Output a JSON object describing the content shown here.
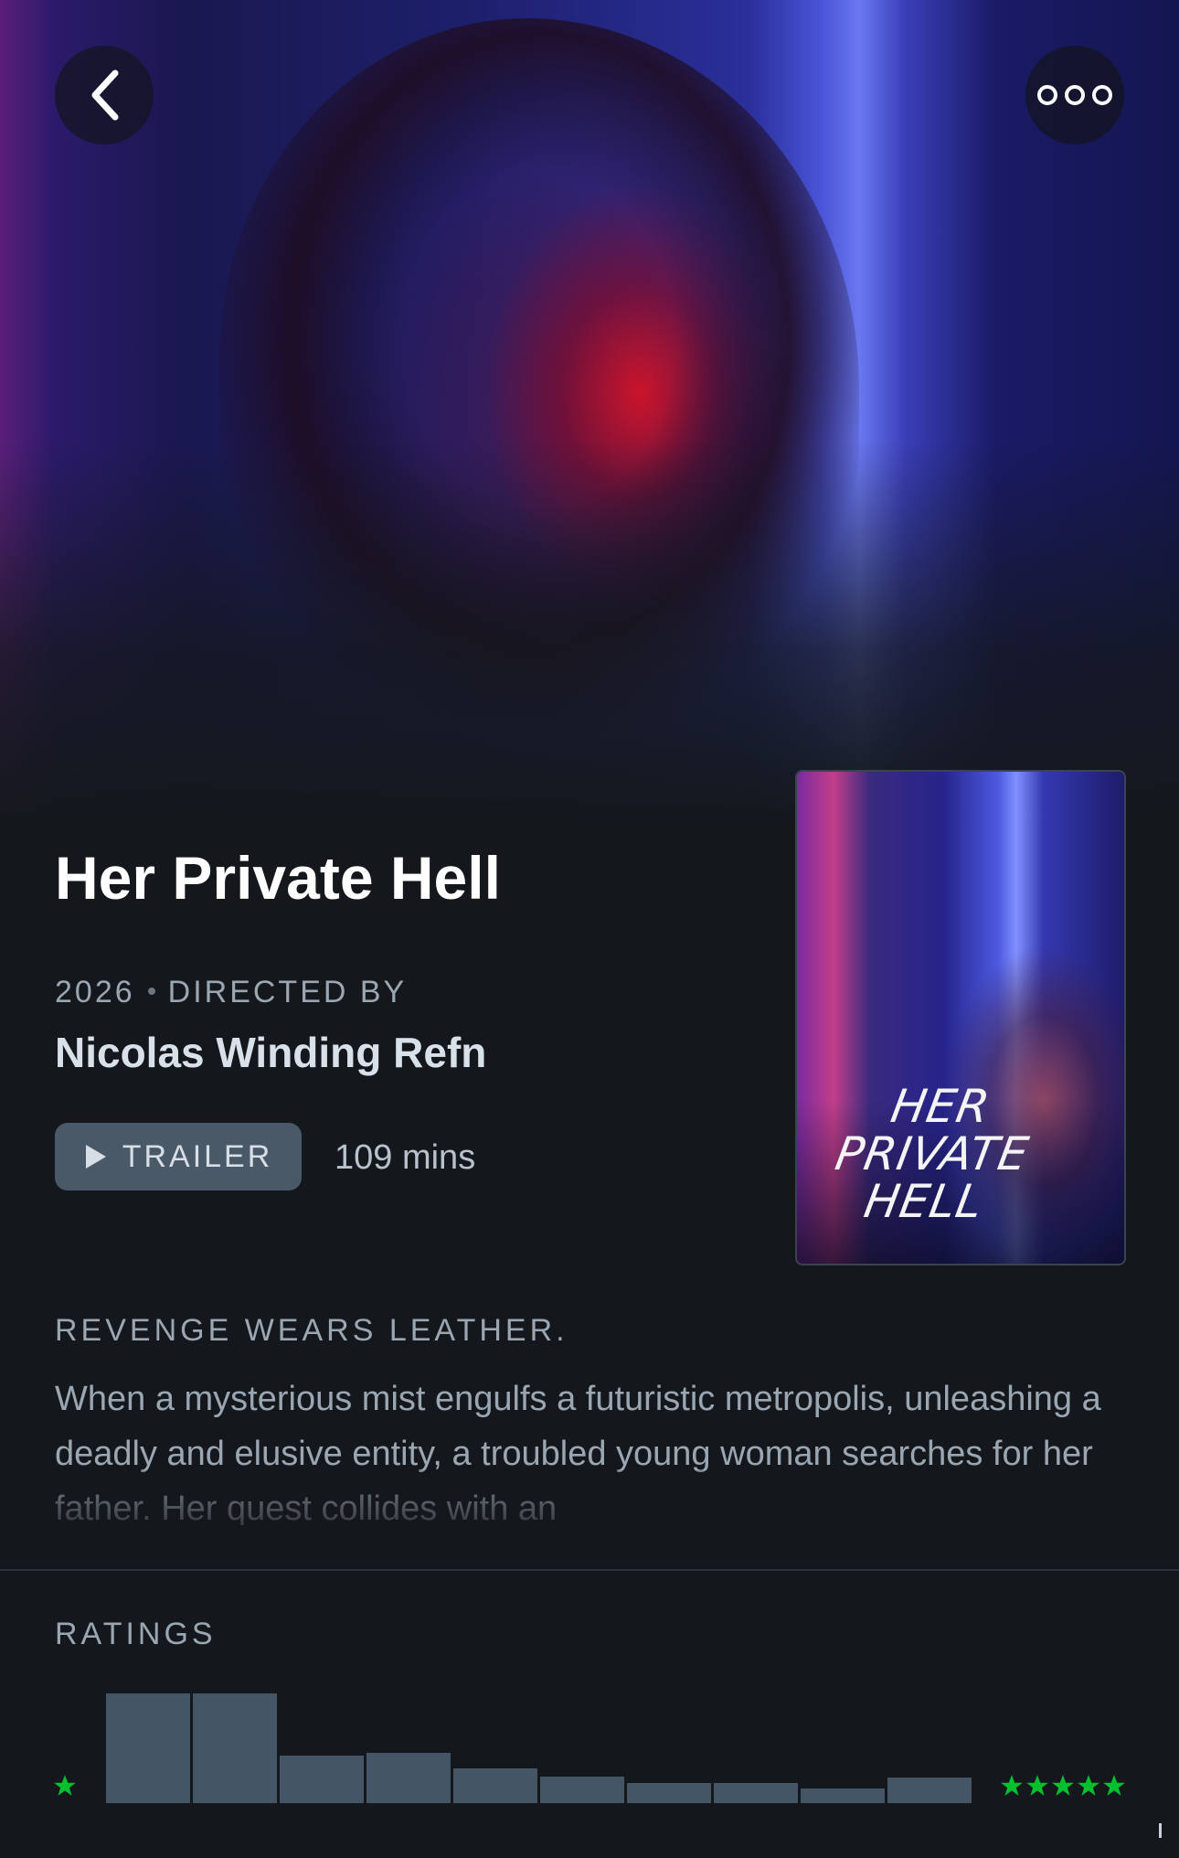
{
  "header": {
    "back_icon": "chevron-left-icon",
    "more_icon": "ellipsis-icon"
  },
  "film": {
    "title": "Her Private Hell",
    "year": "2026",
    "directed_by_label": "DIRECTED BY",
    "director": "Nicolas Winding Refn",
    "trailer_label": "TRAILER",
    "runtime": "109 mins",
    "poster_title_lines": [
      "HER",
      "PRIVATE",
      "HELL"
    ]
  },
  "synopsis": {
    "tagline": "REVENGE WEARS LEATHER.",
    "text": "When a mysterious mist engulfs a futuristic metropolis, unleashing a deadly and elusive entity, a troubled young woman searches for her father. Her quest collides with an"
  },
  "ratings": {
    "label": "RATINGS",
    "histogram": [
      1.0,
      1.0,
      0.43,
      0.46,
      0.32,
      0.24,
      0.18,
      0.18,
      0.13,
      0.23
    ],
    "min_stars": 1,
    "max_stars": 5,
    "star_color": "#00c030",
    "bar_color": "#445566"
  }
}
